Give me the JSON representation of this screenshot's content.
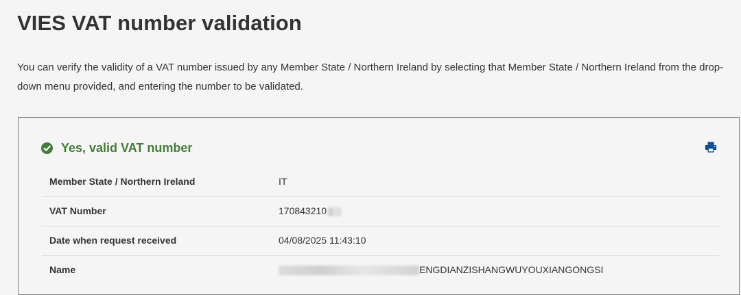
{
  "page": {
    "title": "VIES VAT number validation",
    "intro": "You can verify the validity of a VAT number issued by any Member State / Northern Ireland by selecting that Member State / Northern Ireland from the drop-down menu provided, and entering the number to be validated."
  },
  "result": {
    "status_text": "Yes, valid VAT number",
    "status_color": "#467a39",
    "print_icon": "print-icon",
    "rows": [
      {
        "label": "Member State / Northern Ireland",
        "value": "IT"
      },
      {
        "label": "VAT Number",
        "value": "170843210"
      },
      {
        "label": "Date when request received",
        "value": "04/08/2025 11:43:10"
      },
      {
        "label": "Name",
        "value": "ENGDIANZISHANGWUYOUXIANGONGSI"
      }
    ]
  }
}
